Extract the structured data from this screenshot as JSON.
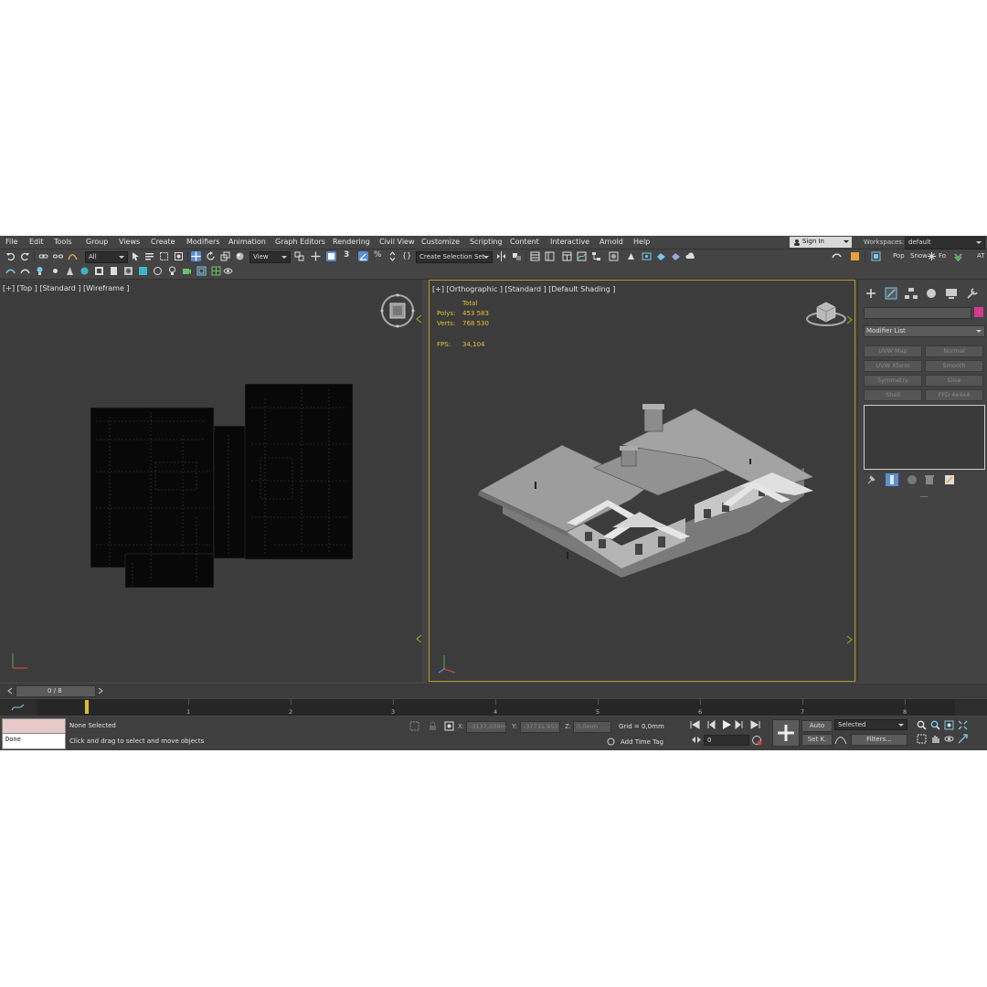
{
  "menu": [
    "File",
    "Edit",
    "Tools",
    "Group",
    "Views",
    "Create",
    "Modifiers",
    "Animation",
    "Graph Editors",
    "Rendering",
    "Civil View",
    "Customize",
    "Scripting",
    "Content",
    "Interactive",
    "Arnold",
    "Help"
  ],
  "account": {
    "sign_in": "Sign In",
    "workspaces_label": "Workspaces:",
    "workspace_value": "default"
  },
  "toolbar": {
    "filter_value": "All",
    "ref_coord_value": "View",
    "snap_label": "3",
    "selection_set_placeholder": "Create Selection Set",
    "right_labels": [
      "Pop",
      "Snow",
      "Fo",
      "AT"
    ]
  },
  "viewports": {
    "left": {
      "label": "[+] [Top ] [Standard ] [Wireframe ]"
    },
    "right": {
      "label": "[+] [Orthographic ] [Standard ] [Default Shading ]",
      "stats": {
        "total_label": "Total",
        "polys_label": "Polys:",
        "polys_value": "453 583",
        "verts_label": "Verts:",
        "verts_value": "768 530",
        "fps_label": "FPS:",
        "fps_value": "34,104"
      }
    }
  },
  "command_panel": {
    "modifier_list_label": "Modifier List",
    "modifier_buttons": [
      "UVW Map",
      "Normal",
      "UVW Xform",
      "Smooth",
      "Symmetry",
      "Slice",
      "Shell",
      "FFD 4x4x4"
    ],
    "color_swatch": "#d23a8d"
  },
  "timeline": {
    "frame_counter": "0 / 8",
    "ticks": [
      "1",
      "2",
      "3",
      "4",
      "5",
      "6",
      "7",
      "8"
    ]
  },
  "status": {
    "listener_output": "Done",
    "selection_status": "None Selected",
    "prompt": "Click and drag to select and move objects",
    "x_label": "X:",
    "x_value": "-3137,039m",
    "y_label": "Y:",
    "y_value": "-37731,953",
    "z_label": "Z:",
    "z_value": "0,0mm",
    "grid": "Grid = 0,0mm",
    "add_time_tag": "Add Time Tag",
    "auto_label": "Auto",
    "set_key_label": "Set K.",
    "key_mode_value": "Selected",
    "filters_label": "Filters...",
    "frame_value": "0"
  },
  "colors": {
    "accent_yellow": "#b89a24",
    "active_blue": "#5b8fd4"
  }
}
